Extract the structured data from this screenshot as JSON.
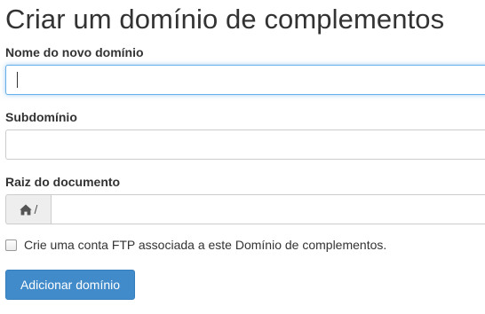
{
  "page": {
    "title": "Criar um domínio de complementos"
  },
  "form": {
    "domain": {
      "label": "Nome do novo domínio",
      "value": ""
    },
    "subdomain": {
      "label": "Subdomínio",
      "value": ""
    },
    "docroot": {
      "label": "Raiz do documento",
      "prefix": "/",
      "prefix_icon": "home-icon",
      "value": ""
    },
    "ftp_checkbox": {
      "label": "Crie uma conta FTP associada a este Domínio de complementos.",
      "checked": false
    },
    "submit_label": "Adicionar domínio"
  },
  "colors": {
    "primary": "#428bca",
    "focus_border": "#66afe9",
    "addon_bg": "#eeeeee"
  }
}
